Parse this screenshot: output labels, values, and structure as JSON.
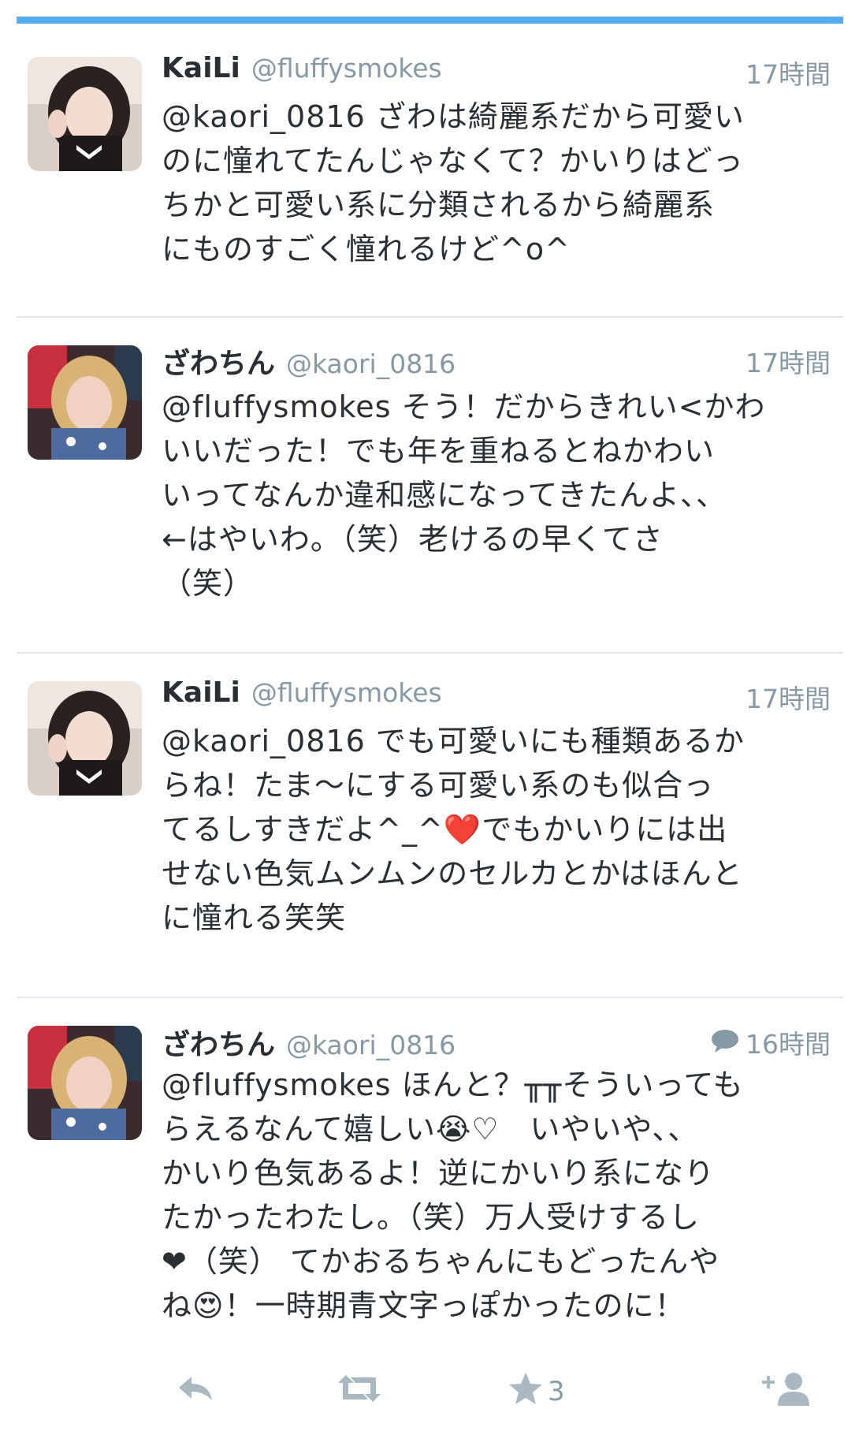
{
  "colors": {
    "accent": "#55acee",
    "text": "#292f33",
    "muted": "#8899a6",
    "divider": "#e1e8ed"
  },
  "tweets": [
    {
      "name": "KaiLi",
      "handle": "@fluffysmokes",
      "time": "17時間",
      "reply_indicator": false,
      "lines": [
        "@kaori_0816 ざわは綺麗系だから可愛い",
        "のに憧れてたんじゃなくて？かいりはどっ",
        "ちかと可愛い系に分類されるから綺麗系",
        "にものすごく憧れるけど^o^"
      ]
    },
    {
      "name": "ざわちん",
      "handle": "@kaori_0816",
      "time": "17時間",
      "reply_indicator": false,
      "lines": [
        "@fluffysmokes そう！だからきれい<かわ",
        "いいだった！でも年を重ねるとねかわい",
        "いってなんか違和感になってきたんよ、、",
        "←はやいわ。（笑）老けるの早くてさ",
        "（笑）"
      ]
    },
    {
      "name": "KaiLi",
      "handle": "@fluffysmokes",
      "time": "17時間",
      "reply_indicator": false,
      "lines": [
        "@kaori_0816 でも可愛いにも種類あるか",
        "らね！たま〜にする可愛い系のも似合っ",
        "てるしすきだよ^_^❤️でもかいりには出",
        "せない色気ムンムンのセルカとかはほんと",
        "に憧れる笑笑"
      ]
    },
    {
      "name": "ざわちん",
      "handle": "@kaori_0816",
      "time": "16時間",
      "reply_indicator": true,
      "lines": [
        "@fluffysmokes ほんと？╥╥そういっても",
        "らえるなんて嬉しい😭♡　いやいや、、",
        "かいり色気あるよ！逆にかいり系になり",
        "たかったわたし。（笑）万人受けするし",
        "❤（笑） てかおるちゃんにもどったんや",
        "ね😍！一時期青文字っぽかったのに！"
      ]
    }
  ],
  "actions": {
    "reply_icon": "reply-icon",
    "retweet_icon": "retweet-icon",
    "favorite_icon": "star-icon",
    "favorite_count": "3",
    "follow_icon": "add-user-icon"
  }
}
